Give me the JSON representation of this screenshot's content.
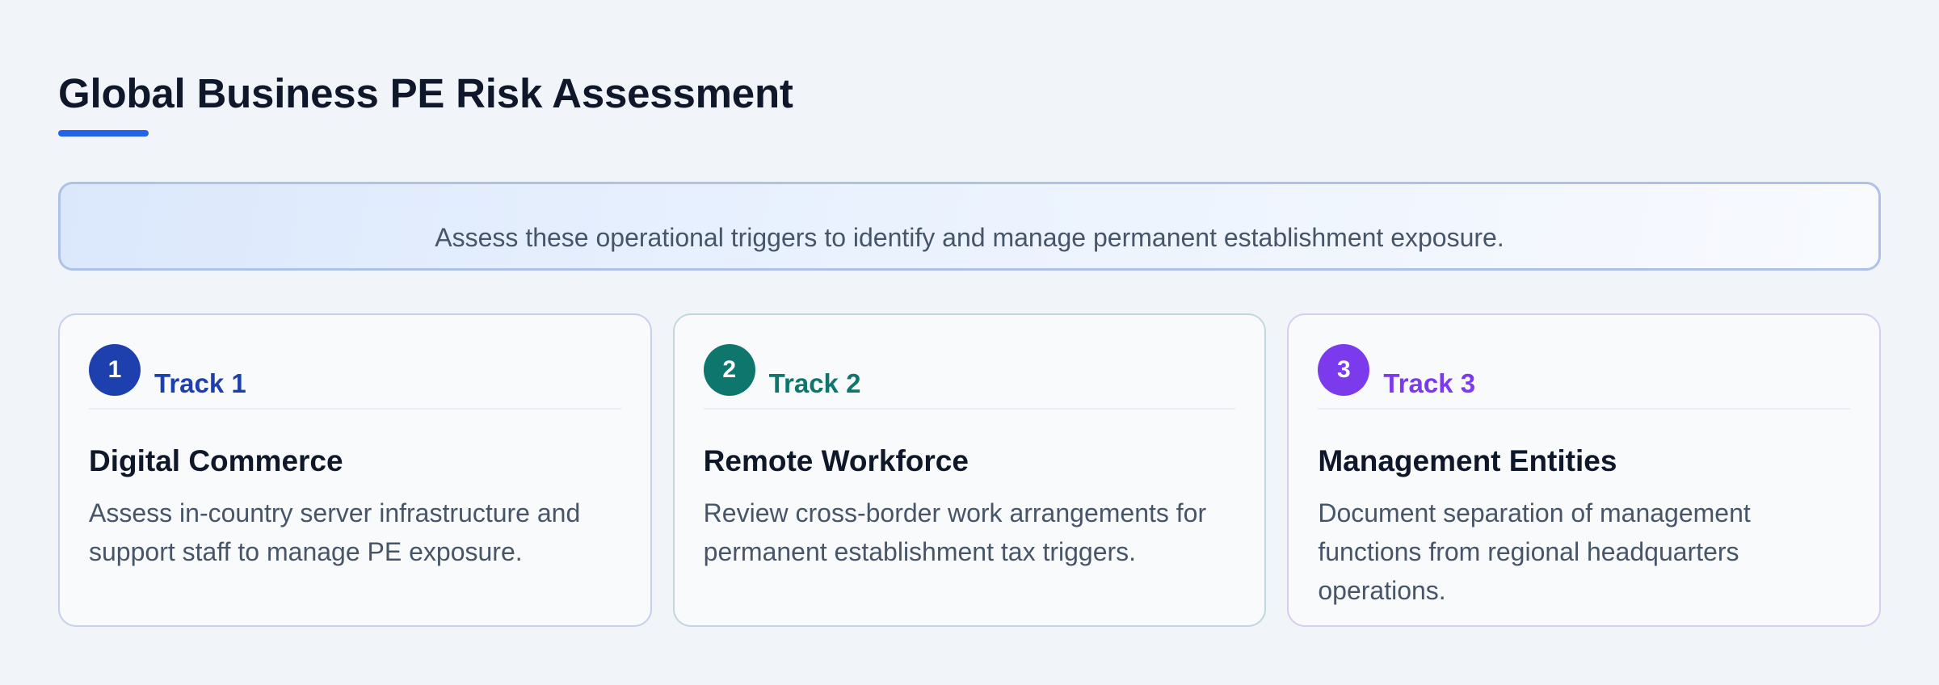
{
  "header": {
    "title": "Global Business PE Risk Assessment"
  },
  "banner": {
    "text": "Assess these operational triggers to identify and manage permanent establishment exposure."
  },
  "tracks": [
    {
      "number": "1",
      "label": "Track 1",
      "title": "Digital Commerce",
      "description": "Assess in-country server infrastructure and support staff to manage PE exposure.",
      "accent": "#1e40af"
    },
    {
      "number": "2",
      "label": "Track 2",
      "title": "Remote Workforce",
      "description": "Review cross-border work arrangements for permanent establishment tax triggers.",
      "accent": "#0f766e"
    },
    {
      "number": "3",
      "label": "Track 3",
      "title": "Management Entities",
      "description": "Document separation of management functions from regional headquarters operations.",
      "accent": "#7c3aed"
    }
  ],
  "colors": {
    "title_underline": "#2563eb",
    "background": "#f1f5f9"
  }
}
